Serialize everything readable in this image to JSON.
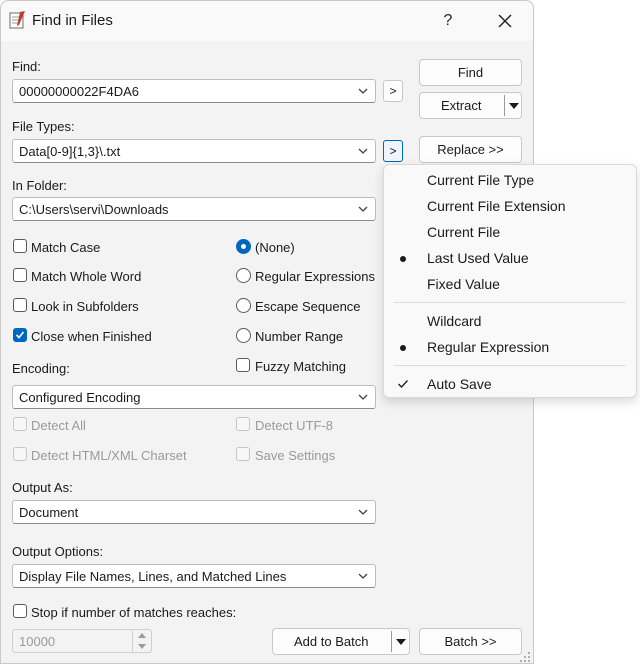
{
  "window": {
    "title": "Find in Files",
    "help": "?"
  },
  "find": {
    "label": "Find:",
    "value": "00000000022F4DA6",
    "more": ">"
  },
  "file_types": {
    "label": "File Types:",
    "value": "Data[0-9]{1,3}\\.txt",
    "more": ">"
  },
  "folder": {
    "label": "In Folder:",
    "value": "C:\\Users\\servi\\Downloads"
  },
  "buttons": {
    "find": "Find",
    "extract": "Extract",
    "replace": "Replace >>",
    "add_to_batch": "Add to Batch",
    "batch": "Batch >>"
  },
  "options": {
    "match_case": "Match Case",
    "match_whole_word": "Match Whole Word",
    "look_in_subfolders": "Look in Subfolders",
    "close_when_finished": "Close when Finished",
    "none": "(None)",
    "regular_expressions": "Regular Expressions",
    "escape_sequence": "Escape Sequence",
    "number_range": "Number Range",
    "fuzzy_matching": "Fuzzy Matching"
  },
  "encoding": {
    "label": "Encoding:",
    "value": "Configured Encoding",
    "detect_all": "Detect All",
    "detect_utf8": "Detect UTF-8",
    "detect_charset": "Detect HTML/XML Charset",
    "save_settings": "Save Settings"
  },
  "output_as": {
    "label": "Output As:",
    "value": "Document"
  },
  "output_options": {
    "label": "Output Options:",
    "value": "Display File Names, Lines, and Matched Lines"
  },
  "stop": {
    "label": "Stop if number of matches reaches:",
    "value": "10000"
  },
  "menu": {
    "items": [
      "Current File Type",
      "Current File Extension",
      "Current File",
      "Last Used Value",
      "Fixed Value",
      "Wildcard",
      "Regular Expression",
      "Auto Save"
    ]
  },
  "colors": {
    "accent": "#0067c0",
    "dialog_bg": "#f3f3f3"
  }
}
